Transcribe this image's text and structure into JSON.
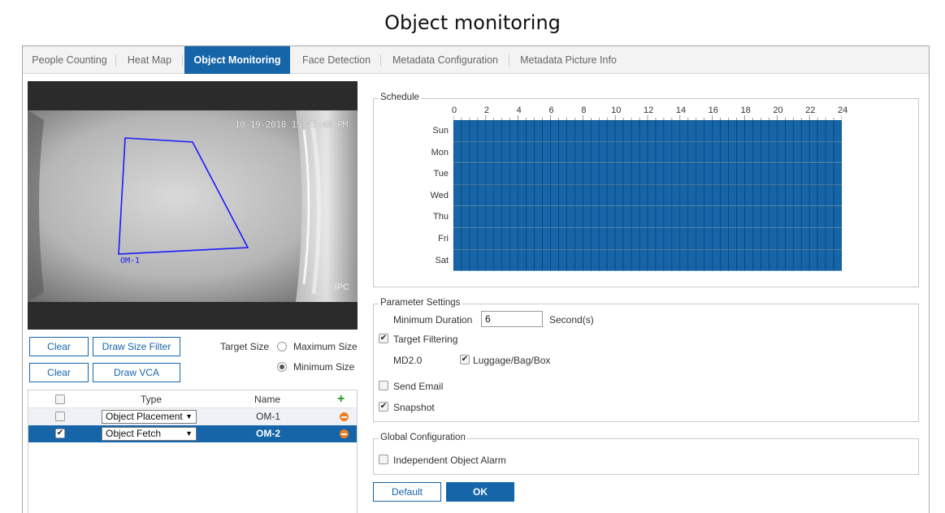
{
  "page_title": "Object monitoring",
  "tabs": [
    {
      "label": "People Counting",
      "active": false
    },
    {
      "label": "Heat Map",
      "active": false
    },
    {
      "label": "Object Monitoring",
      "active": true
    },
    {
      "label": "Face Detection",
      "active": false
    },
    {
      "label": "Metadata Configuration",
      "active": false
    },
    {
      "label": "Metadata Picture Info",
      "active": false
    }
  ],
  "video": {
    "timestamp": "10-19-2018 15:45:48 PM",
    "overlay_tag": "IPC",
    "zone_label": "OM-1"
  },
  "controls": {
    "clear_label": "Clear",
    "draw_size_filter_label": "Draw Size Filter",
    "draw_vca_label": "Draw VCA",
    "target_size_label": "Target Size",
    "max_size_label": "Maximum Size",
    "min_size_label": "Minimum Size",
    "target_size_selected": "Minimum Size"
  },
  "rule_table": {
    "headers": {
      "type": "Type",
      "name": "Name"
    },
    "rows": [
      {
        "checked": false,
        "type": "Object Placement",
        "name": "OM-1",
        "selected": false
      },
      {
        "checked": true,
        "type": "Object Fetch",
        "name": "OM-2",
        "selected": true
      }
    ]
  },
  "schedule": {
    "legend": "Schedule",
    "hour_labels": [
      "0",
      "2",
      "4",
      "6",
      "8",
      "10",
      "12",
      "14",
      "16",
      "18",
      "20",
      "22",
      "24"
    ],
    "days": [
      "Sun",
      "Mon",
      "Tue",
      "Wed",
      "Thu",
      "Fri",
      "Sat"
    ],
    "fill_color": "#1565a8",
    "all_hours_active": true
  },
  "parameters": {
    "legend": "Parameter Settings",
    "min_duration_label": "Minimum Duration",
    "min_duration_value": "6",
    "unit": "Second(s)",
    "target_filtering_label": "Target Filtering",
    "target_filtering_checked": true,
    "md_label": "MD2.0",
    "luggage_label": "Luggage/Bag/Box",
    "luggage_checked": true,
    "send_email_label": "Send Email",
    "send_email_checked": false,
    "snapshot_label": "Snapshot",
    "snapshot_checked": true
  },
  "global": {
    "legend": "Global Configuration",
    "independent_alarm_label": "Independent Object Alarm",
    "independent_alarm_checked": false
  },
  "footer": {
    "default_label": "Default",
    "ok_label": "OK"
  },
  "colors": {
    "accent": "#1565a8",
    "zone_line": "#1a1aff",
    "delete": "#f07d22",
    "add": "#2a9a2a"
  }
}
